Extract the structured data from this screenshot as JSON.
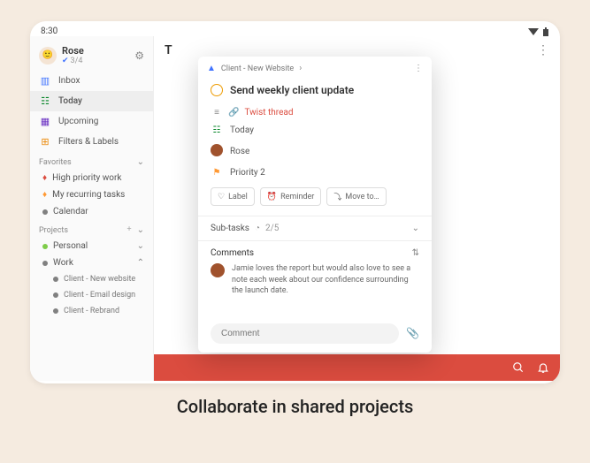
{
  "status": {
    "time": "8:30"
  },
  "profile": {
    "name": "Rose",
    "count": "3/4"
  },
  "nav": {
    "inbox": "Inbox",
    "today": "Today",
    "upcoming": "Upcoming",
    "filters": "Filters & Labels"
  },
  "sections": {
    "favorites": "Favorites",
    "projects": "Projects"
  },
  "favorites": [
    {
      "label": "High priority work",
      "color": "#db4c3f"
    },
    {
      "label": "My recurring tasks",
      "color": "#ff9933"
    },
    {
      "label": "Calendar",
      "color": "#808080"
    }
  ],
  "projects": {
    "personal": "Personal",
    "work": "Work",
    "work_children": [
      "Client - New website",
      "Client - Email design",
      "Client - Rebrand"
    ]
  },
  "main": {
    "title_initial": "T"
  },
  "task": {
    "breadcrumb": "Client - New Website",
    "title": "Send weekly client update",
    "twist_label": "Twist thread",
    "date": "Today",
    "assignee": "Rose",
    "priority": "Priority 2",
    "chips": {
      "label": "Label",
      "reminder": "Reminder",
      "move": "Move to…"
    },
    "subtasks": {
      "label": "Sub-tasks",
      "progress": "2/5"
    },
    "comments": {
      "label": "Comments",
      "text": "Jamie loves the report but would also love to see a note each week about our confidence surrounding the launch date."
    },
    "comment_placeholder": "Comment"
  },
  "caption": "Collaborate in shared projects"
}
